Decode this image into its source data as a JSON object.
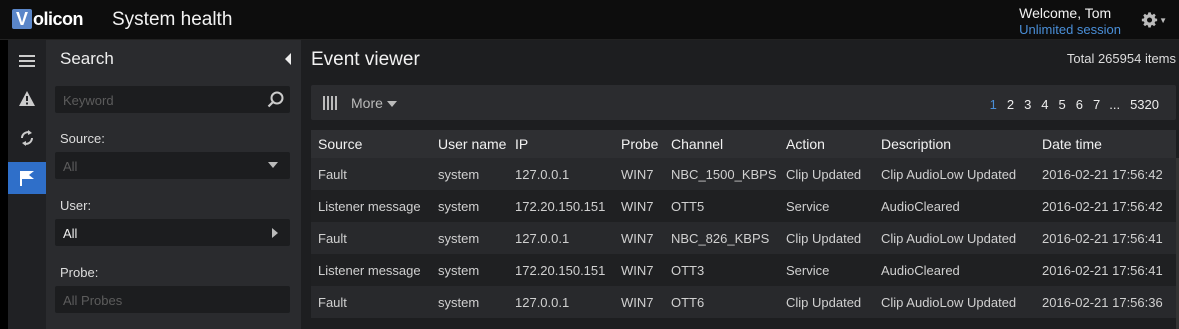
{
  "header": {
    "logo_initial": "V",
    "logo_rest": "olicon",
    "title": "System health",
    "welcome": "Welcome, Tom",
    "session": "Unlimited session"
  },
  "rail": [
    {
      "icon": "menu-icon",
      "active": false
    },
    {
      "icon": "alarm-icon",
      "active": false
    },
    {
      "icon": "refresh-icon",
      "active": false
    },
    {
      "icon": "flag-icon",
      "active": true
    }
  ],
  "search": {
    "title": "Search",
    "keyword_placeholder": "Keyword",
    "source_label": "Source:",
    "source_value": "All",
    "user_label": "User:",
    "user_value": "All",
    "probe_label": "Probe:",
    "probe_value": "All Probes"
  },
  "main": {
    "title": "Event viewer",
    "total": "Total 265954 items",
    "more_label": "More",
    "pages": [
      "1",
      "2",
      "3",
      "4",
      "5",
      "6",
      "7",
      "...",
      "5320"
    ],
    "current_page": "1"
  },
  "table": {
    "columns": [
      "Source",
      "User name",
      "IP",
      "Probe",
      "Channel",
      "Action",
      "Description",
      "Date time"
    ],
    "rows": [
      [
        "Fault",
        "system",
        "127.0.0.1",
        "WIN7",
        "NBC_1500_KBPS",
        "Clip Updated",
        "Clip AudioLow Updated",
        "2016-02-21 17:56:42"
      ],
      [
        "Listener message",
        "system",
        "172.20.150.151",
        "WIN7",
        "OTT5",
        "Service",
        "AudioCleared",
        "2016-02-21 17:56:42"
      ],
      [
        "Fault",
        "system",
        "127.0.0.1",
        "WIN7",
        "NBC_826_KBPS",
        "Clip Updated",
        "Clip AudioLow Updated",
        "2016-02-21 17:56:41"
      ],
      [
        "Listener message",
        "system",
        "172.20.150.151",
        "WIN7",
        "OTT3",
        "Service",
        "AudioCleared",
        "2016-02-21 17:56:41"
      ],
      [
        "Fault",
        "system",
        "127.0.0.1",
        "WIN7",
        "OTT6",
        "Clip Updated",
        "Clip AudioLow Updated",
        "2016-02-21 17:56:36"
      ]
    ]
  },
  "colors": {
    "accent": "#4a8fd8",
    "active_rail": "#2f6fc9",
    "logo": "#5a86c9"
  }
}
